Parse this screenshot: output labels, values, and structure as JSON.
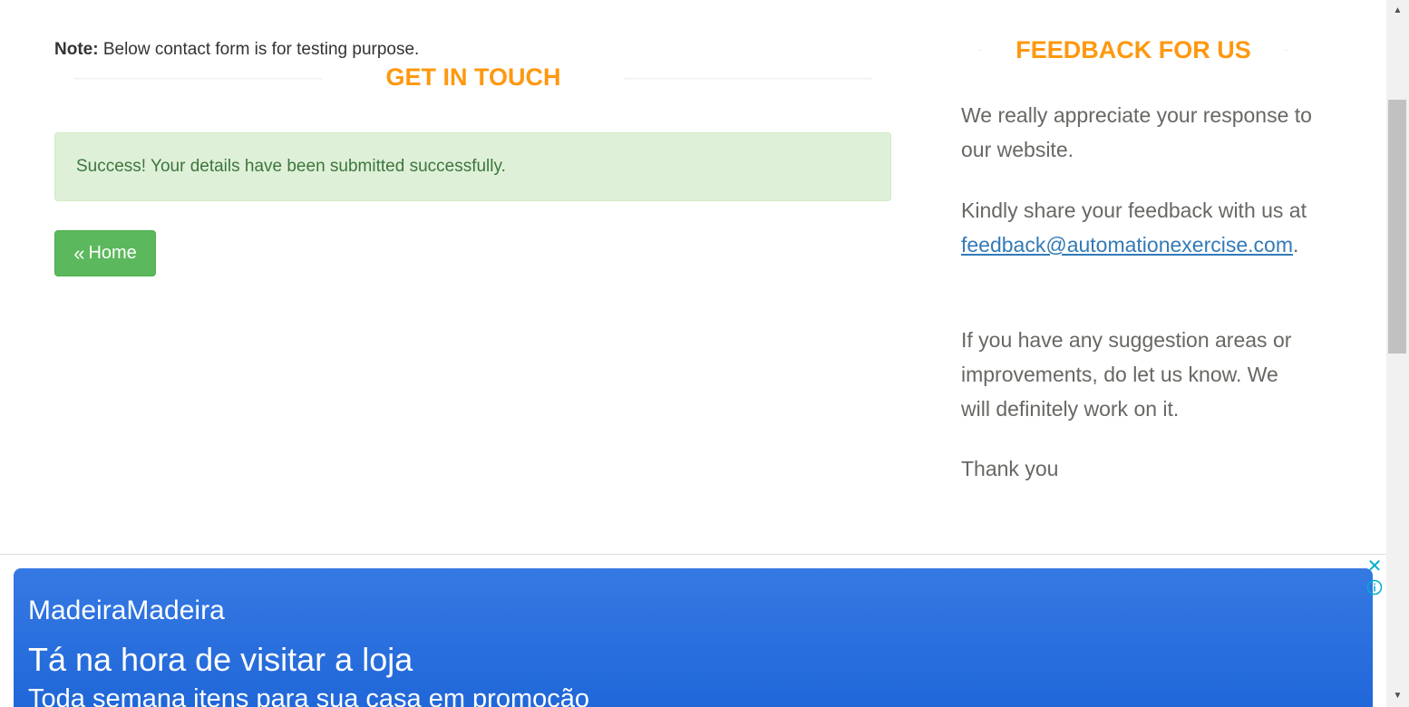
{
  "contact": {
    "note_label": "Note:",
    "note_text": " Below contact form is for testing purpose.",
    "title": "GET IN TOUCH",
    "success_message": "Success! Your details have been submitted successfully.",
    "home_button": "Home",
    "home_icon": "«"
  },
  "feedback": {
    "title": "FEEDBACK FOR US",
    "para1": "We really appreciate your response to our website.",
    "para2_prefix": "Kindly share your feedback with us at",
    "email": "feedback@automationexercise.com",
    "para2_suffix": ".",
    "para3": "If you have any suggestion areas or improvements, do let us know. We will definitely work on it.",
    "para4": "Thank you"
  },
  "ad": {
    "brand": "MadeiraMadeira",
    "headline": "Tá na hora de visitar a loja",
    "subline": "Toda semana itens para sua casa em promoção",
    "close_icon": "✕",
    "info_icon": "info-icon"
  },
  "colors": {
    "accent": "#FE980F",
    "success_bg": "#dff0d8",
    "success_text": "#3c763d",
    "button_green": "#5cb85c",
    "ad_blue": "#2a6fdf",
    "link": "#337ab7"
  }
}
